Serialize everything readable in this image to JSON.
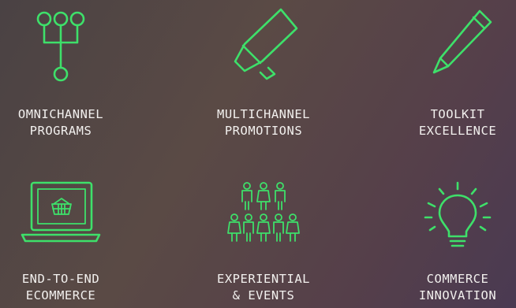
{
  "tiles": [
    {
      "label": "OMNICHANNEL\nPROGRAMS",
      "icon": "network-icon"
    },
    {
      "label": "MULTICHANNEL\nPROMOTIONS",
      "icon": "megaphone-icon"
    },
    {
      "label": "TOOLKIT\nEXCELLENCE",
      "icon": "pencil-icon"
    },
    {
      "label": "END-TO-END\nECOMMERCE",
      "icon": "laptop-basket-icon"
    },
    {
      "label": "EXPERIENTIAL\n& EVENTS",
      "icon": "people-group-icon"
    },
    {
      "label": "COMMERCE\nINNOVATION",
      "icon": "lightbulb-icon"
    }
  ],
  "colors": {
    "accent": "#3ee06a",
    "text": "#f2f0ee"
  }
}
